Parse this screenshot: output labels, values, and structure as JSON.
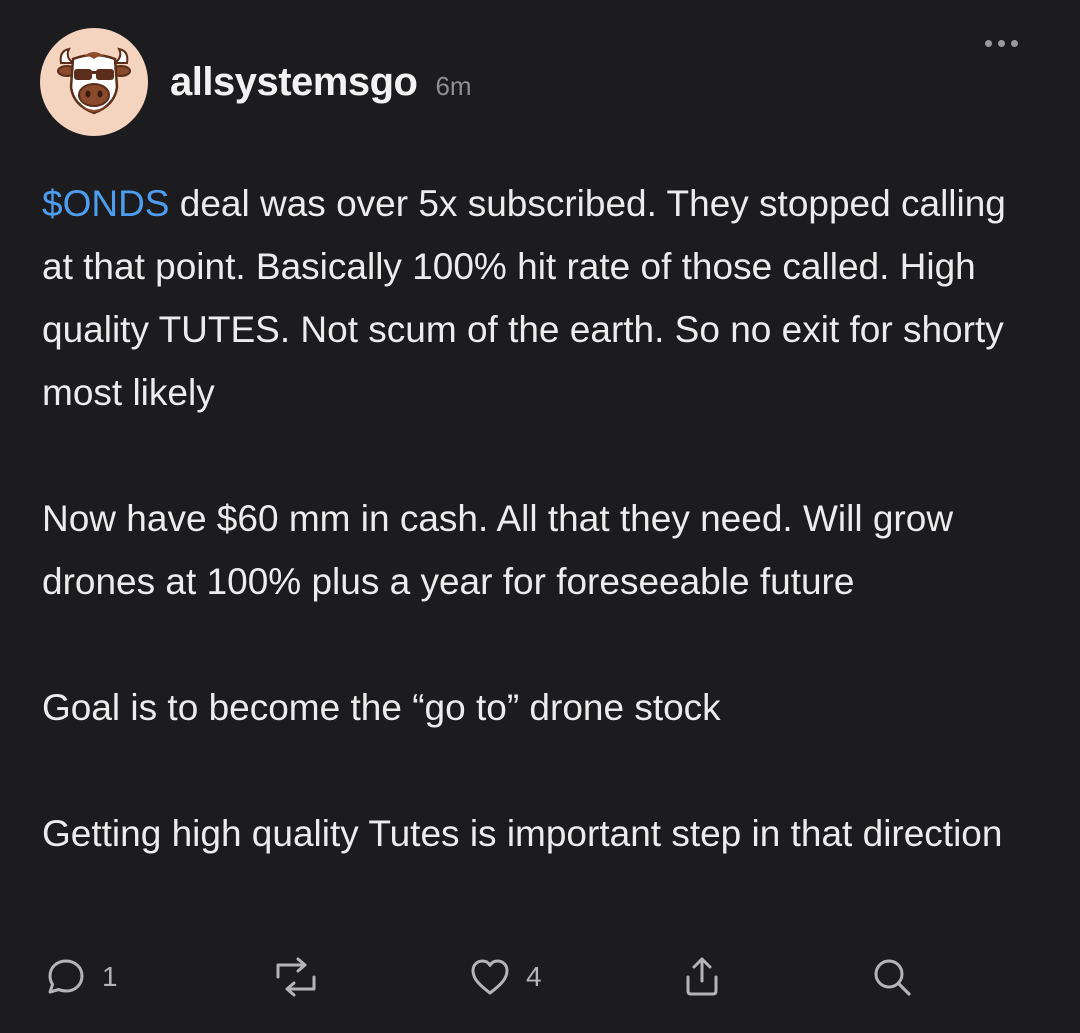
{
  "post": {
    "username": "allsystemsgo",
    "timestamp": "6m",
    "avatar_icon": "bull-with-sunglasses-icon",
    "paragraphs": [
      {
        "ticker": "$ONDS",
        "text": " deal was over 5x subscribed. They stopped calling at that point. Basically 100% hit rate of those called. High quality TUTES. Not scum of the earth. So no exit for shorty most likely"
      },
      {
        "text": "Now have $60 mm in cash. All that they need. Will grow drones at 100% plus a year for foreseeable future"
      },
      {
        "text": "Goal is to become the “go to” drone stock"
      },
      {
        "text": "Getting high quality Tutes is important step in that direction"
      }
    ]
  },
  "actions": {
    "reply_count": "1",
    "like_count": "4",
    "icons": [
      "comment-icon",
      "repost-icon",
      "heart-icon",
      "share-icon",
      "search-icon"
    ]
  },
  "colors": {
    "background": "#1c1c1e",
    "text": "#ececec",
    "ticker": "#4d9df0",
    "muted": "#8e8e93",
    "avatar_bg": "#f4d3bf"
  }
}
